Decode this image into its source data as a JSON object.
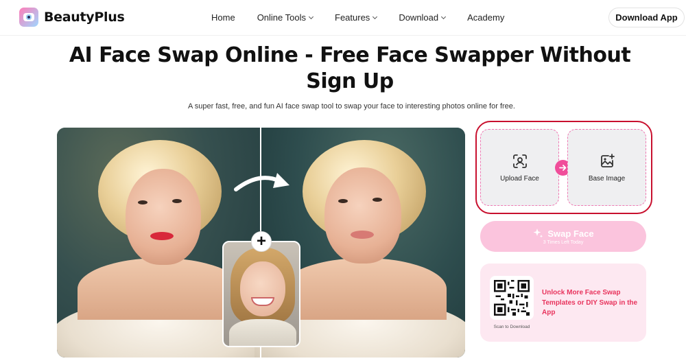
{
  "brand": {
    "name": "BeautyPlus"
  },
  "nav": {
    "items": [
      {
        "label": "Home",
        "has_dropdown": false
      },
      {
        "label": "Online Tools",
        "has_dropdown": true
      },
      {
        "label": "Features",
        "has_dropdown": true
      },
      {
        "label": "Download",
        "has_dropdown": true
      },
      {
        "label": "Academy",
        "has_dropdown": false
      }
    ],
    "cta_label": "Download App"
  },
  "hero": {
    "title": "AI Face Swap Online - Free Face Swapper Without Sign Up",
    "subtitle": "A super fast, free, and fun AI face swap tool to swap your face to interesting photos online for free."
  },
  "demo": {
    "plus_symbol": "+",
    "icons": [
      "curved-arrow-icon",
      "plus-icon"
    ]
  },
  "uploader": {
    "face_label": "Upload Face",
    "base_label": "Base Image",
    "accent_color": "#f04d9a",
    "highlight_color": "#c8102e"
  },
  "swap": {
    "label": "Swap Face",
    "sub_label": "3 Times Left Today",
    "color": "#fbc4dd"
  },
  "promo": {
    "text": "Unlock More Face Swap Templates or DIY Swap in the App",
    "scan_label": "Scan to Download",
    "text_color": "#e8345d"
  }
}
